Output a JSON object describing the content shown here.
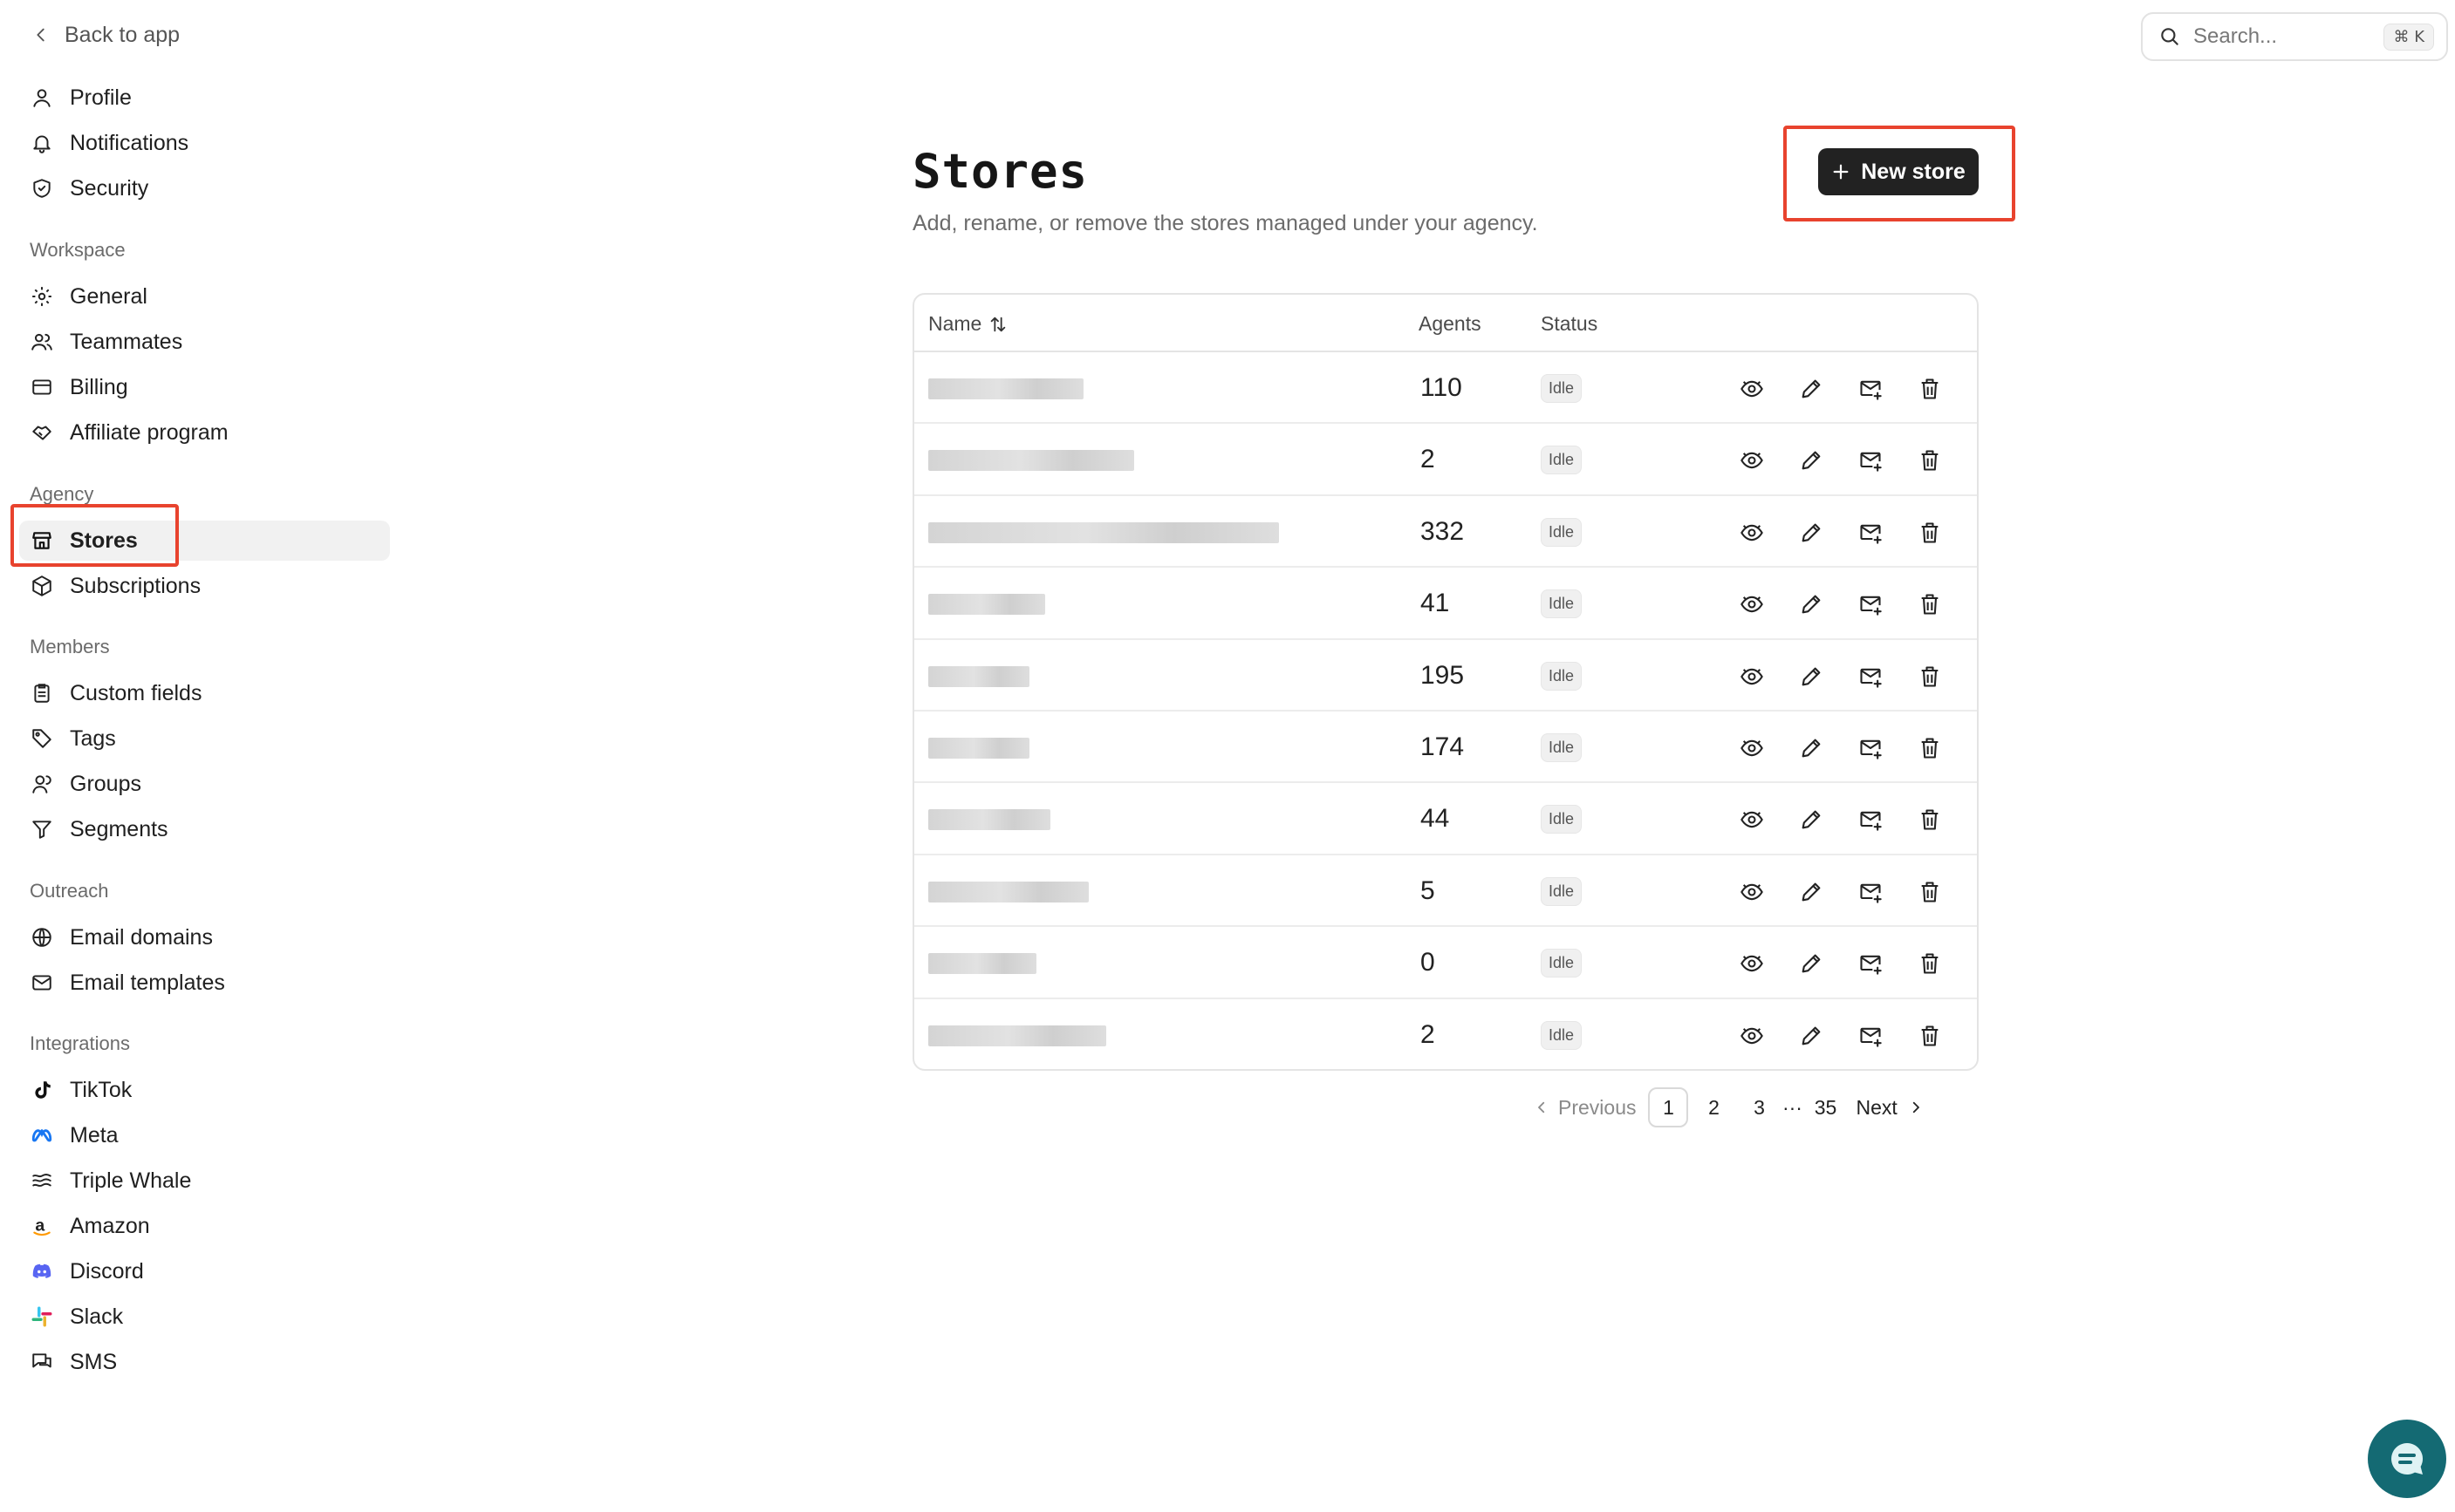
{
  "back": {
    "label": "Back to app"
  },
  "search": {
    "placeholder": "Search...",
    "shortcut": "⌘ K"
  },
  "sidebar": {
    "account": [
      {
        "label": "Profile",
        "icon": "user-icon"
      },
      {
        "label": "Notifications",
        "icon": "bell-icon"
      },
      {
        "label": "Security",
        "icon": "shield-icon"
      }
    ],
    "workspace_label": "Workspace",
    "workspace": [
      {
        "label": "General",
        "icon": "gear-icon"
      },
      {
        "label": "Teammates",
        "icon": "users-icon"
      },
      {
        "label": "Billing",
        "icon": "credit-card-icon"
      },
      {
        "label": "Affiliate program",
        "icon": "handshake-icon"
      }
    ],
    "agency_label": "Agency",
    "agency": [
      {
        "label": "Stores",
        "icon": "store-icon",
        "active": true
      },
      {
        "label": "Subscriptions",
        "icon": "package-icon"
      }
    ],
    "members_label": "Members",
    "members": [
      {
        "label": "Custom fields",
        "icon": "clipboard-list-icon"
      },
      {
        "label": "Tags",
        "icon": "tag-icon"
      },
      {
        "label": "Groups",
        "icon": "group-icon"
      },
      {
        "label": "Segments",
        "icon": "filter-icon"
      }
    ],
    "outreach_label": "Outreach",
    "outreach": [
      {
        "label": "Email domains",
        "icon": "globe-icon"
      },
      {
        "label": "Email templates",
        "icon": "mail-icon"
      }
    ],
    "integrations_label": "Integrations",
    "integrations": [
      {
        "label": "TikTok",
        "icon": "tiktok-icon"
      },
      {
        "label": "Meta",
        "icon": "meta-icon"
      },
      {
        "label": "Triple Whale",
        "icon": "triple-whale-icon"
      },
      {
        "label": "Amazon",
        "icon": "amazon-icon"
      },
      {
        "label": "Discord",
        "icon": "discord-icon"
      },
      {
        "label": "Slack",
        "icon": "slack-icon"
      },
      {
        "label": "SMS",
        "icon": "sms-icon"
      }
    ]
  },
  "page": {
    "title": "Stores",
    "subtitle": "Add, rename, or remove the stores managed under your agency.",
    "new_store_label": "New store"
  },
  "table": {
    "columns": {
      "name": "Name",
      "agents": "Agents",
      "status": "Status"
    },
    "rows": [
      {
        "agents": "110",
        "status": "Idle"
      },
      {
        "agents": "2",
        "status": "Idle"
      },
      {
        "agents": "332",
        "status": "Idle"
      },
      {
        "agents": "41",
        "status": "Idle"
      },
      {
        "agents": "195",
        "status": "Idle"
      },
      {
        "agents": "174",
        "status": "Idle"
      },
      {
        "agents": "44",
        "status": "Idle"
      },
      {
        "agents": "5",
        "status": "Idle"
      },
      {
        "agents": "0",
        "status": "Idle"
      },
      {
        "agents": "2",
        "status": "Idle"
      }
    ]
  },
  "pagination": {
    "previous": "Previous",
    "next": "Next",
    "pages": [
      "1",
      "2",
      "3"
    ],
    "ellipsis": "···",
    "last": "35",
    "current": "1"
  },
  "colors": {
    "highlight": "#e8432e",
    "button": "#222222",
    "chat": "#146a73"
  }
}
